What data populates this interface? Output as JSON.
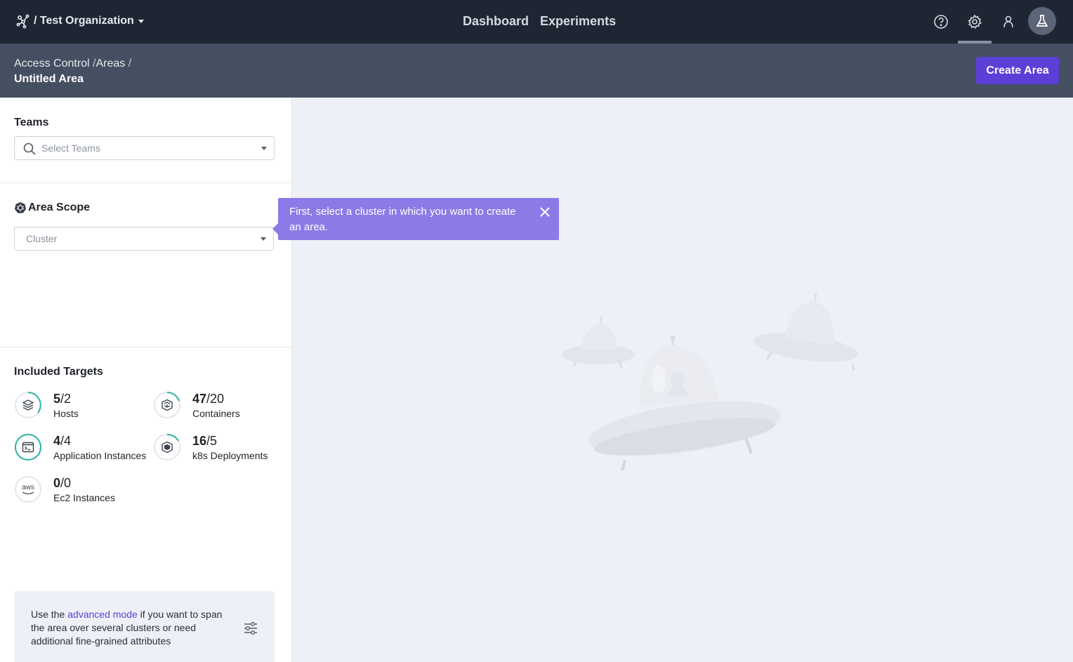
{
  "nav": {
    "org_label": "/ Test Organization",
    "links": [
      "Dashboard",
      "Experiments"
    ],
    "icons": [
      "help-icon",
      "gear-icon",
      "user-icon",
      "flask-icon"
    ]
  },
  "subheader": {
    "breadcrumb": [
      "Access Control",
      "Areas"
    ],
    "title": "Untitled Area",
    "create_label": "Create Area"
  },
  "teams": {
    "title": "Teams",
    "placeholder": "Select Teams"
  },
  "scope": {
    "title": "Area Scope",
    "placeholder": "Cluster"
  },
  "tooltip": {
    "text": "First, select a cluster in which you want to create an area."
  },
  "targets": {
    "title": "Included Targets",
    "items": [
      {
        "count": "5",
        "total": "/2",
        "label": "Hosts",
        "icon": "stack-icon"
      },
      {
        "count": "47",
        "total": "/20",
        "label": "Containers",
        "icon": "container-icon"
      },
      {
        "count": "4",
        "total": "/4",
        "label": "Application Instances",
        "icon": "terminal-window-icon"
      },
      {
        "count": "16",
        "total": "/5",
        "label": "k8s Deployments",
        "icon": "hexagon-icon"
      },
      {
        "count": "0",
        "total": "/0",
        "label": "Ec2 Instances",
        "icon": "aws-icon"
      }
    ]
  },
  "info": {
    "prefix": "Use the ",
    "link": "advanced mode",
    "suffix": " if you want to span the area over several clusters or need additional fine-grained attributes"
  },
  "colors": {
    "accent": "#5b3fd6",
    "tooltip": "#8d7ae6",
    "ring": "#2bb3a3"
  }
}
